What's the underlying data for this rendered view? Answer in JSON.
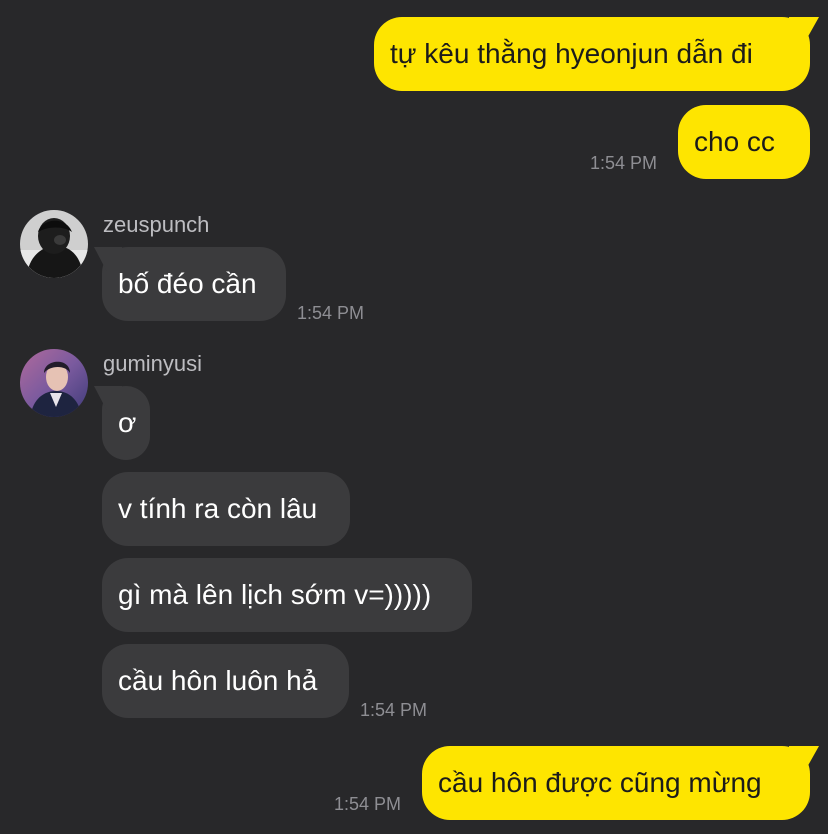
{
  "colors": {
    "background": "#28282a",
    "outgoing_bubble": "#fee500",
    "incoming_bubble": "#3b3b3d",
    "timestamp": "#8e8e93"
  },
  "messages": {
    "out_1": {
      "text": "tự kêu thằng hyeonjun dẫn đi"
    },
    "out_2": {
      "text": "cho cc",
      "time": "1:54 PM"
    },
    "zeuspunch": {
      "sender": "zeuspunch",
      "avatar_icon": "profile-photo-dark",
      "text": "bố đéo cần",
      "time": "1:54 PM"
    },
    "guminyusi": {
      "sender": "guminyusi",
      "avatar_icon": "profile-photo-suit",
      "lines": [
        "ơ",
        "v tính ra còn lâu",
        "gì mà lên lịch sớm v=)))))",
        "cầu hôn luôn hả"
      ],
      "time": "1:54 PM"
    },
    "out_3": {
      "text": "cầu hôn được cũng mừng",
      "time": "1:54 PM"
    }
  }
}
